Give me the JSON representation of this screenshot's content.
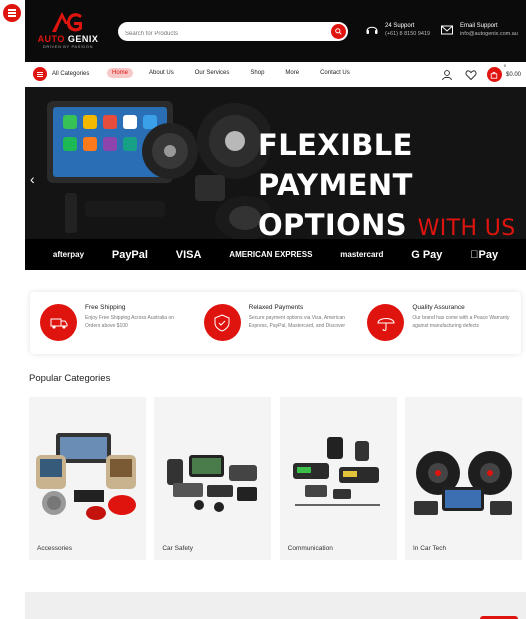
{
  "brand": {
    "name_part1": "AUTO",
    "name_part2": "GENIX",
    "tagline": "DRIVEN BY PASSION",
    "accent_color": "#e0140f"
  },
  "search": {
    "placeholder": "Search for Products"
  },
  "contacts": [
    {
      "icon": "headset-icon",
      "title": "24 Support",
      "value": "(+61) 8 8150 9419"
    },
    {
      "icon": "mail-icon",
      "title": "Email Support",
      "value": "info@autogenix.com.au"
    }
  ],
  "nav": {
    "categories_label": "All Categories",
    "links": [
      "Home",
      "About Us",
      "Our Services",
      "Shop",
      "More",
      "Contact Us"
    ],
    "cart_count": "0",
    "cart_total": "$0.00"
  },
  "hero": {
    "line1": "FLEXIBLE PAYMENT",
    "line2": "OPTIONS",
    "line2_accent": "WITH US",
    "payment_logos": [
      "afterpay",
      "PayPal",
      "VISA",
      "AMERICAN EXPRESS",
      "mastercard",
      "G Pay",
      "Pay"
    ]
  },
  "features": [
    {
      "icon": "truck-icon",
      "title": "Free Shipping",
      "desc": "Enjoy Free Shipping Across Australia on Orders above $100"
    },
    {
      "icon": "card-shield-icon",
      "title": "Relaxed Payments",
      "desc": "Secure payment options via Visa, American Express, PayPal, Mastercard, and Discover"
    },
    {
      "icon": "umbrella-icon",
      "title": "Quality Assurance",
      "desc": "Our brand has come with a Peace Warranty against manufacturing defects"
    }
  ],
  "popular": {
    "title": "Popular Categories",
    "items": [
      "Accessories",
      "Car Safety",
      "Communication",
      "In Car Tech"
    ]
  }
}
